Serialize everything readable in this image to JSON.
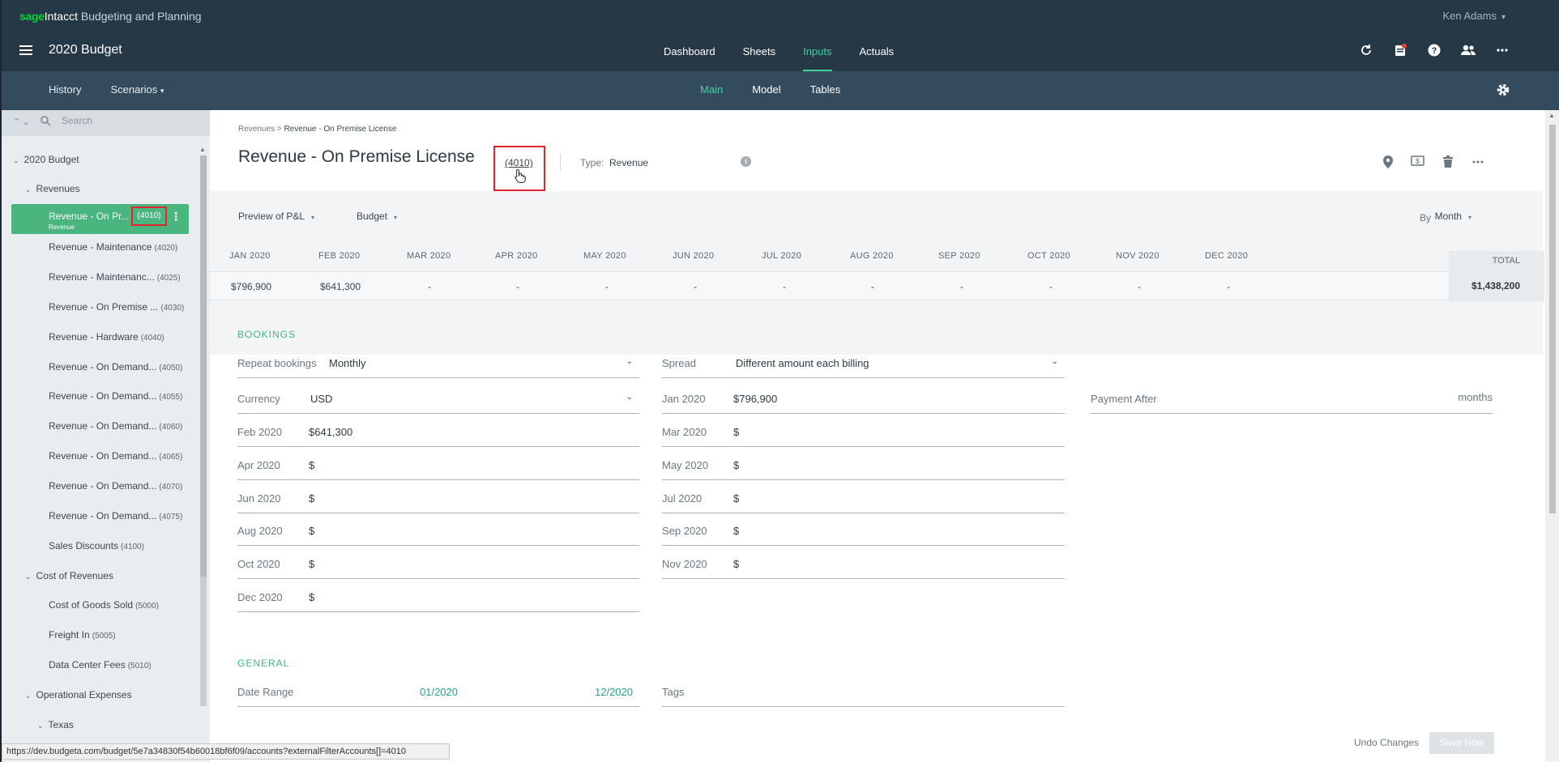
{
  "brand": {
    "sage": "sage",
    "intacct": "Intacct",
    "product": " Budgeting and Planning"
  },
  "user": {
    "name": "Ken Adams"
  },
  "app": {
    "title": "2020 Budget"
  },
  "main_nav": [
    "Dashboard",
    "Sheets",
    "Inputs",
    "Actuals"
  ],
  "main_nav_active": "Inputs",
  "sub_nav": {
    "left": [
      "History",
      "Scenarios"
    ],
    "center": [
      "Main",
      "Model",
      "Tables"
    ],
    "active": "Main"
  },
  "sidebar": {
    "search_placeholder": "Search",
    "root": "2020 Budget",
    "groups": [
      {
        "label": "Revenues"
      },
      {
        "label": "Cost of Revenues"
      },
      {
        "label": "Operational Expenses"
      },
      {
        "label": "Texas"
      }
    ],
    "selected": {
      "label": "Revenue - On Pr...",
      "sublabel": "Revenue",
      "code": "(4010)"
    },
    "revenue_items": [
      {
        "label": "Revenue - Maintenance",
        "code": "(4020)"
      },
      {
        "label": "Revenue - Maintenanc...",
        "code": "(4025)"
      },
      {
        "label": "Revenue - On Premise ...",
        "code": "(4030)"
      },
      {
        "label": "Revenue - Hardware",
        "code": "(4040)"
      },
      {
        "label": "Revenue - On Demand...",
        "code": "(4050)"
      },
      {
        "label": "Revenue - On Demand...",
        "code": "(4055)"
      },
      {
        "label": "Revenue - On Demand...",
        "code": "(4060)"
      },
      {
        "label": "Revenue - On Demand...",
        "code": "(4065)"
      },
      {
        "label": "Revenue - On Demand...",
        "code": "(4070)"
      },
      {
        "label": "Revenue - On Demand...",
        "code": "(4075)"
      },
      {
        "label": "Sales Discounts",
        "code": "(4100)"
      }
    ],
    "cost_items": [
      {
        "label": "Cost of Goods Sold",
        "code": "(5000)"
      },
      {
        "label": "Freight In",
        "code": "(5005)"
      },
      {
        "label": "Data Center Fees",
        "code": "(5010)"
      }
    ]
  },
  "breadcrumb": {
    "parent": "Revenues",
    "sep": " > ",
    "current": "Revenue - On Premise License"
  },
  "page": {
    "title": "Revenue - On Premise License",
    "code": "(4010)",
    "type_label": "Type:",
    "type_value": "Revenue"
  },
  "filters": {
    "preview": "Preview of P&L",
    "scenario": "Budget",
    "by_label": "By",
    "by_value": "Month"
  },
  "months": [
    "JAN 2020",
    "FEB 2020",
    "MAR 2020",
    "APR 2020",
    "MAY 2020",
    "JUN 2020",
    "JUL 2020",
    "AUG 2020",
    "SEP 2020",
    "OCT 2020",
    "NOV 2020",
    "DEC 2020"
  ],
  "month_values": [
    "$796,900",
    "$641,300",
    "-",
    "-",
    "-",
    "-",
    "-",
    "-",
    "-",
    "-",
    "-",
    "-"
  ],
  "total": {
    "label": "TOTAL",
    "value": "$1,438,200"
  },
  "bookings": {
    "heading": "BOOKINGS",
    "repeat_label": "Repeat bookings",
    "repeat_value": "Monthly",
    "spread_label": "Spread",
    "spread_value": "Different amount each billing",
    "currency_label": "Currency",
    "currency_value": "USD",
    "payment_label": "Payment After",
    "payment_unit": "months",
    "amounts": [
      {
        "label": "Jan 2020",
        "value": "$796,900"
      },
      {
        "label": "Feb 2020",
        "value": "$641,300"
      },
      {
        "label": "Mar 2020",
        "value": "$"
      },
      {
        "label": "Apr 2020",
        "value": "$"
      },
      {
        "label": "May 2020",
        "value": "$"
      },
      {
        "label": "Jun 2020",
        "value": "$"
      },
      {
        "label": "Jul 2020",
        "value": "$"
      },
      {
        "label": "Aug 2020",
        "value": "$"
      },
      {
        "label": "Sep 2020",
        "value": "$"
      },
      {
        "label": "Oct 2020",
        "value": "$"
      },
      {
        "label": "Nov 2020",
        "value": "$"
      },
      {
        "label": "Dec 2020",
        "value": "$"
      }
    ]
  },
  "general": {
    "heading": "GENERAL",
    "date_range_label": "Date Range",
    "date_from": "01/2020",
    "date_to": "12/2020",
    "tags_label": "Tags"
  },
  "footer": {
    "undo": "Undo Changes",
    "save": "Save Now",
    "status_url": "https://dev.budgeta.com/budget/5e7a34830f54b60018bf6f09/accounts?externalFilterAccounts[]=4010"
  },
  "colors": {
    "topbar": "#263745",
    "subbar": "#344b5d",
    "accent": "#3fd3a0",
    "selected": "#4ab57f",
    "highlight": "#e0262c"
  }
}
